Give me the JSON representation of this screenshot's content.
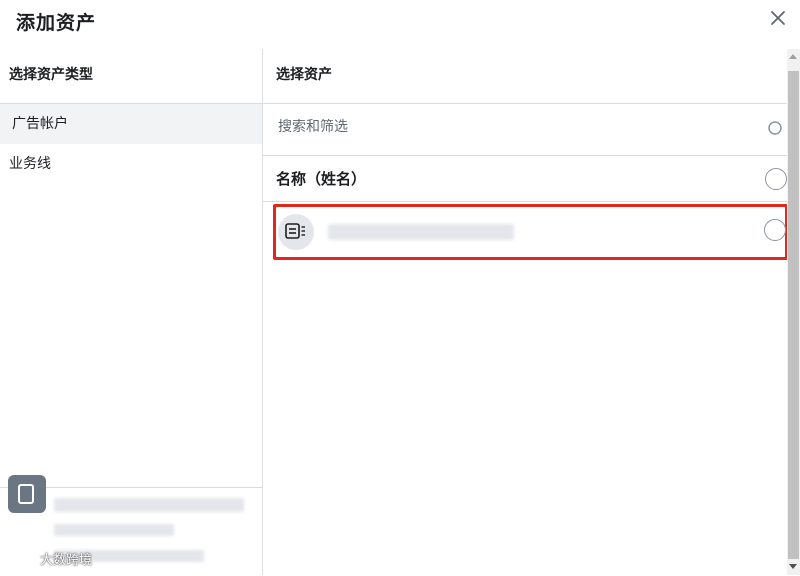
{
  "dialog": {
    "title": "添加资产",
    "close_icon": "close-icon"
  },
  "left_panel": {
    "header": "选择资产类型",
    "items": [
      {
        "label": "广告帐户",
        "selected": true
      },
      {
        "label": "业务线",
        "selected": false
      }
    ]
  },
  "right_panel": {
    "header": "选择资产",
    "search": {
      "placeholder": "搜索和筛选",
      "value": ""
    },
    "column_name": "名称（姓名）",
    "assets": [
      {
        "icon": "ad-account-icon",
        "name_redacted": true,
        "selected": false
      }
    ]
  },
  "watermark": {
    "text": "大数跨境"
  },
  "colors": {
    "highlight": "#e0281d",
    "divider": "#dadde1",
    "selected_bg": "#f2f3f5"
  }
}
